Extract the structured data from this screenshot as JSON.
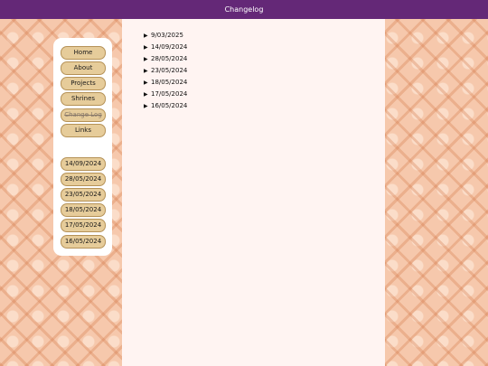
{
  "header": {
    "title": "Changelog"
  },
  "sidebar": {
    "nav": [
      {
        "label": "Home"
      },
      {
        "label": "About"
      },
      {
        "label": "Projects"
      },
      {
        "label": "Shrines"
      },
      {
        "label": "Change Log"
      },
      {
        "label": "Links"
      }
    ],
    "dates": [
      {
        "label": "14/09/2024"
      },
      {
        "label": "28/05/2024"
      },
      {
        "label": "23/05/2024"
      },
      {
        "label": "18/05/2024"
      },
      {
        "label": "17/05/2024"
      },
      {
        "label": "16/05/2024"
      }
    ]
  },
  "main": {
    "entries": [
      {
        "label": "9/03/2025"
      },
      {
        "label": "14/09/2024"
      },
      {
        "label": "28/05/2024"
      },
      {
        "label": "23/05/2024"
      },
      {
        "label": "18/05/2024"
      },
      {
        "label": "17/05/2024"
      },
      {
        "label": "16/05/2024"
      }
    ]
  },
  "colors": {
    "header_bg": "#642877",
    "button_bg": "#e6cc9a",
    "panel_bg": "#fff4f2",
    "background": "#f6c8ac"
  },
  "icons": {
    "disclosure": "disclosure-triangle-right-icon"
  }
}
